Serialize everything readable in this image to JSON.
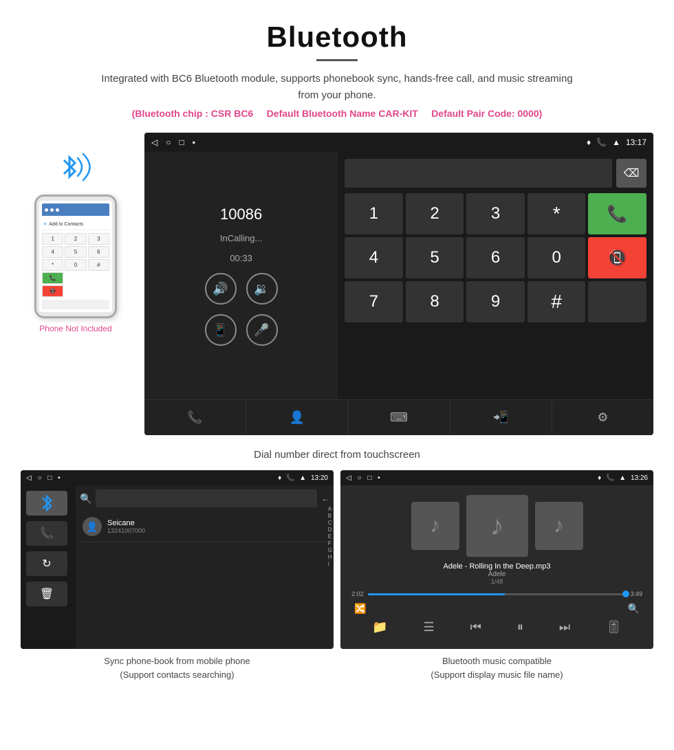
{
  "header": {
    "title": "Bluetooth",
    "subtitle": "Integrated with BC6 Bluetooth module, supports phonebook sync, hands-free call, and music streaming from your phone.",
    "chip_info_prefix": "(Bluetooth chip : CSR BC6",
    "chip_info_name": "Default Bluetooth Name CAR-KIT",
    "chip_info_code": "Default Pair Code: 0000)",
    "phone_not_included": "Phone Not Included"
  },
  "dialer_screen": {
    "status_time": "13:17",
    "call_number": "10086",
    "call_status": "InCalling...",
    "call_timer": "00:33",
    "keys": [
      "1",
      "2",
      "3",
      "4",
      "5",
      "6",
      "7",
      "8",
      "9",
      "*",
      "0",
      "#"
    ],
    "caption": "Dial number direct from touchscreen"
  },
  "phonebook_screen": {
    "status_time": "13:20",
    "contact_name": "Seicane",
    "contact_number": "13241007000",
    "alphabet": [
      "A",
      "B",
      "C",
      "D",
      "E",
      "F",
      "G",
      "H",
      "I"
    ],
    "caption_line1": "Sync phone-book from mobile phone",
    "caption_line2": "(Support contacts searching)"
  },
  "music_screen": {
    "status_time": "13:26",
    "song_title": "Adele - Rolling In the Deep.mp3",
    "artist": "Adele",
    "track_info": "1/48",
    "time_current": "2:02",
    "time_total": "3:49",
    "progress_percent": 53,
    "caption_line1": "Bluetooth music compatible",
    "caption_line2": "(Support display music file name)"
  },
  "icons": {
    "bluetooth": "⌥",
    "volume_up": "🔊",
    "volume_down": "🔉",
    "transfer": "📱",
    "mic": "🎤",
    "phone": "📞",
    "contacts": "👤",
    "keypad": "⌨",
    "settings": "⚙",
    "search": "🔍",
    "shuffle": "🔀",
    "prev": "⏮",
    "play_pause": "⏸",
    "next": "⏭",
    "equalizer": "🎚",
    "folder": "📁",
    "list": "☰",
    "back": "←",
    "trash": "🗑",
    "sync": "↻",
    "call_transfer": "↗"
  }
}
